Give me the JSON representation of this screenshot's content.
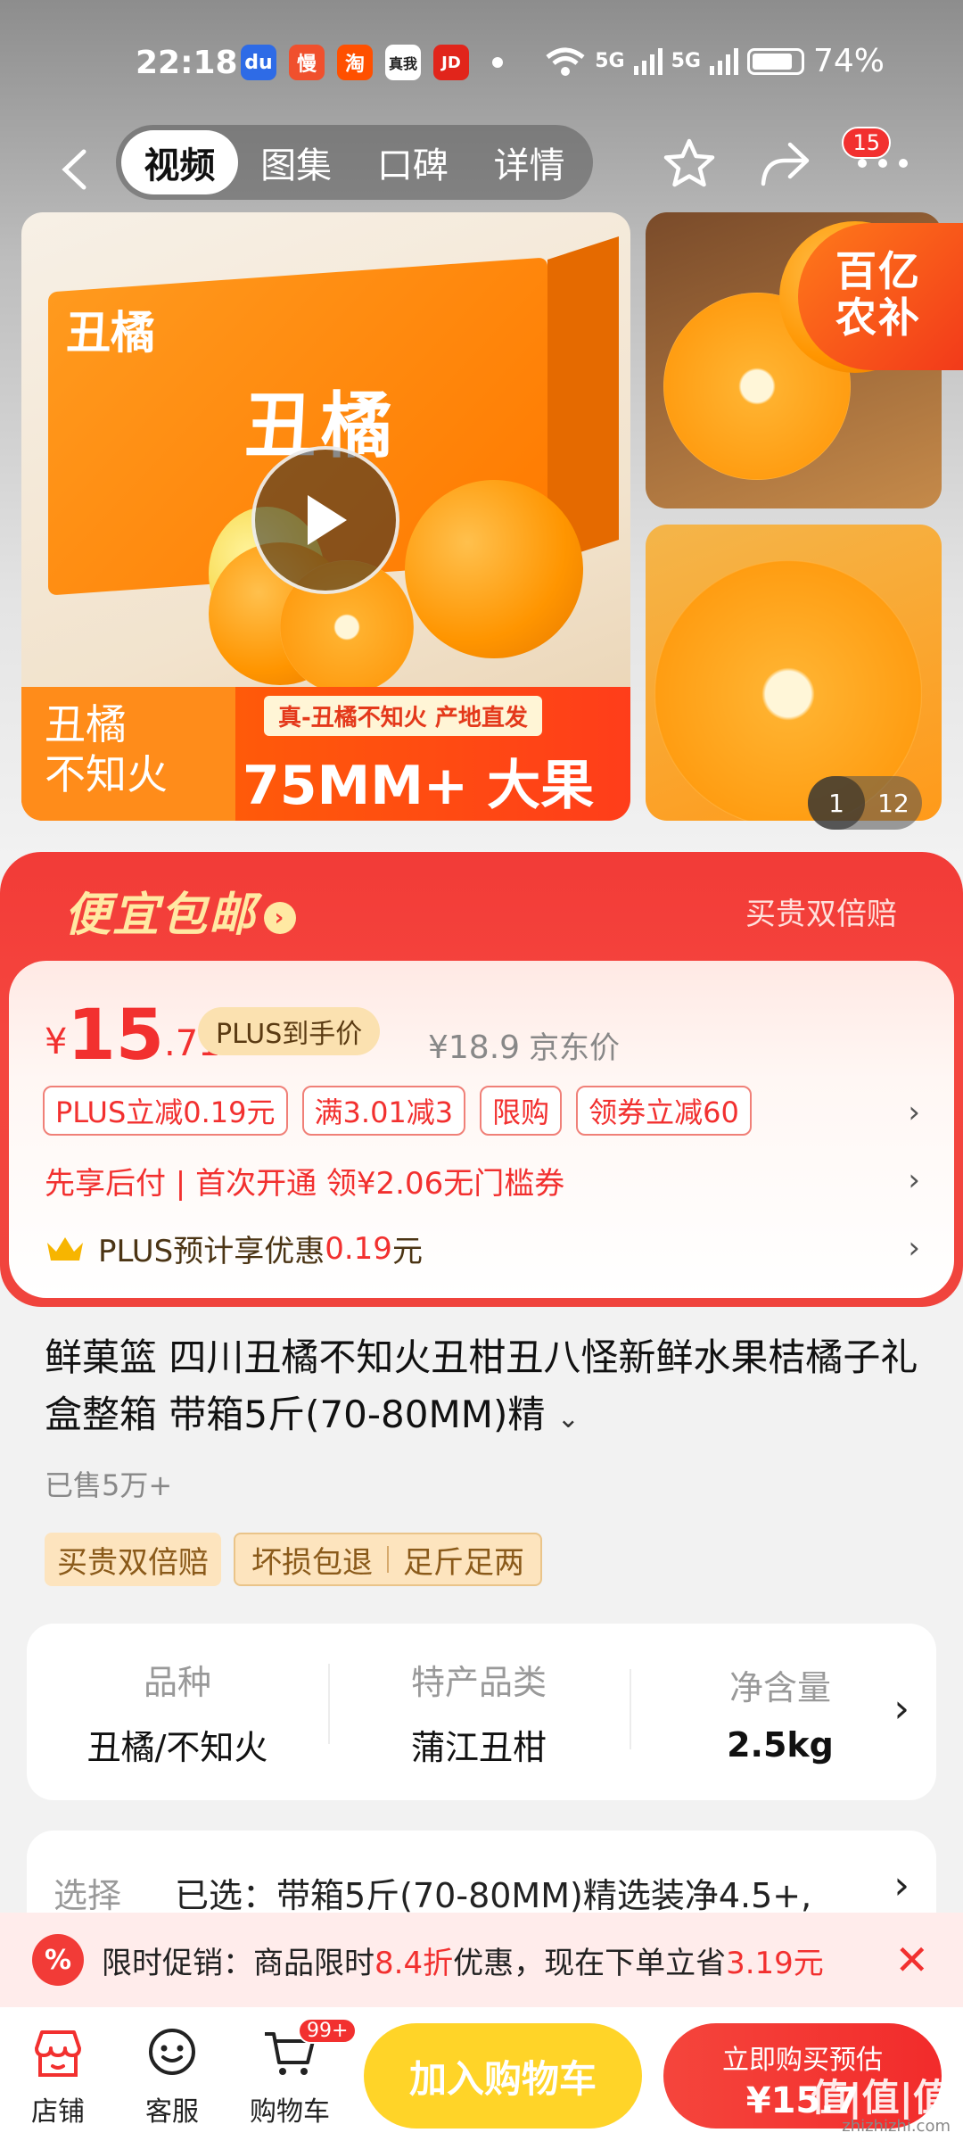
{
  "status_bar": {
    "time": "22:18",
    "apps": [
      {
        "icon": "baidu-icon",
        "color": "#2e6be6",
        "glyph": "du"
      },
      {
        "icon": "slow-app-icon",
        "color": "#f0502d",
        "glyph": "慢"
      },
      {
        "icon": "taobao-icon",
        "color": "#ff5000",
        "glyph": "淘"
      },
      {
        "icon": "realme-icon",
        "color": "#ffffff",
        "glyph": "真我"
      },
      {
        "icon": "jd-icon",
        "color": "#e1251b",
        "glyph": "JD"
      }
    ],
    "net1": "5G",
    "net2": "5G",
    "battery": "74%"
  },
  "nav": {
    "tabs": [
      {
        "label": "视频",
        "active": true
      },
      {
        "label": "图集",
        "active": false
      },
      {
        "label": "口碑",
        "active": false
      },
      {
        "label": "详情",
        "active": false
      }
    ],
    "more_badge": "15"
  },
  "gallery": {
    "main_box_title": "丑橘",
    "main_box_subtitle": "丑橘",
    "banner_tag": "丑橘\n不知火",
    "banner_mid": "真-丑橘不知火 产地直发",
    "banner_big": "75MM+ 大果",
    "badge": "百亿\n农补",
    "counter_current": "1",
    "counter_total": "12"
  },
  "promo": {
    "title": "便宜包邮",
    "right": "买贵双倍赔"
  },
  "price": {
    "symbol": "¥",
    "integer": "15",
    "decimal": ".71",
    "plus_tag": "PLUS到手价",
    "jd_price": "¥18.9",
    "jd_label": "京东价",
    "coupons": [
      "PLUS立减0.19元",
      "满3.01减3",
      "限购",
      "领券立减60"
    ],
    "pay_later": "先享后付 | 首次开通 领¥2.06无门槛券",
    "plus_estimate_prefix": "PLUS预计享优惠",
    "plus_estimate_value": "0.19",
    "plus_estimate_suffix": "元"
  },
  "product": {
    "title": "鲜菓篮  四川丑橘不知火丑柑丑八怪新鲜水果桔橘子礼盒整箱 带箱5斤(70-80MM)精",
    "sold": "已售5万+",
    "tag_primary": "买贵双倍赔",
    "tag_group": [
      "坏损包退",
      "足斤足两"
    ]
  },
  "attributes": [
    {
      "key": "品种",
      "value": "丑橘/不知火"
    },
    {
      "key": "特产品类",
      "value": "蒲江丑柑"
    },
    {
      "key": "净含量",
      "value": "2.5kg"
    }
  ],
  "selection": {
    "label": "选择",
    "value": "已选：带箱5斤(70-80MM)精选装净4.5+,"
  },
  "notice": {
    "icon": "percent-icon",
    "prefix": "限时促销：商品限时",
    "discount": "8.4折",
    "middle": "优惠，现在下单立省",
    "save": "3.19元"
  },
  "bottom": {
    "shop": "店铺",
    "service": "客服",
    "cart": "购物车",
    "cart_badge": "99+",
    "add_cart": "加入购物车",
    "buy_line1": "立即购买预估",
    "buy_line2": "¥15.7",
    "watermark": "值|值|值",
    "watermark_url": "zhizhizhi.com"
  },
  "colors": {
    "accent_red": "#f23b37",
    "cart_yellow": "#ffd428",
    "plus_gold": "#fbe1b0"
  }
}
